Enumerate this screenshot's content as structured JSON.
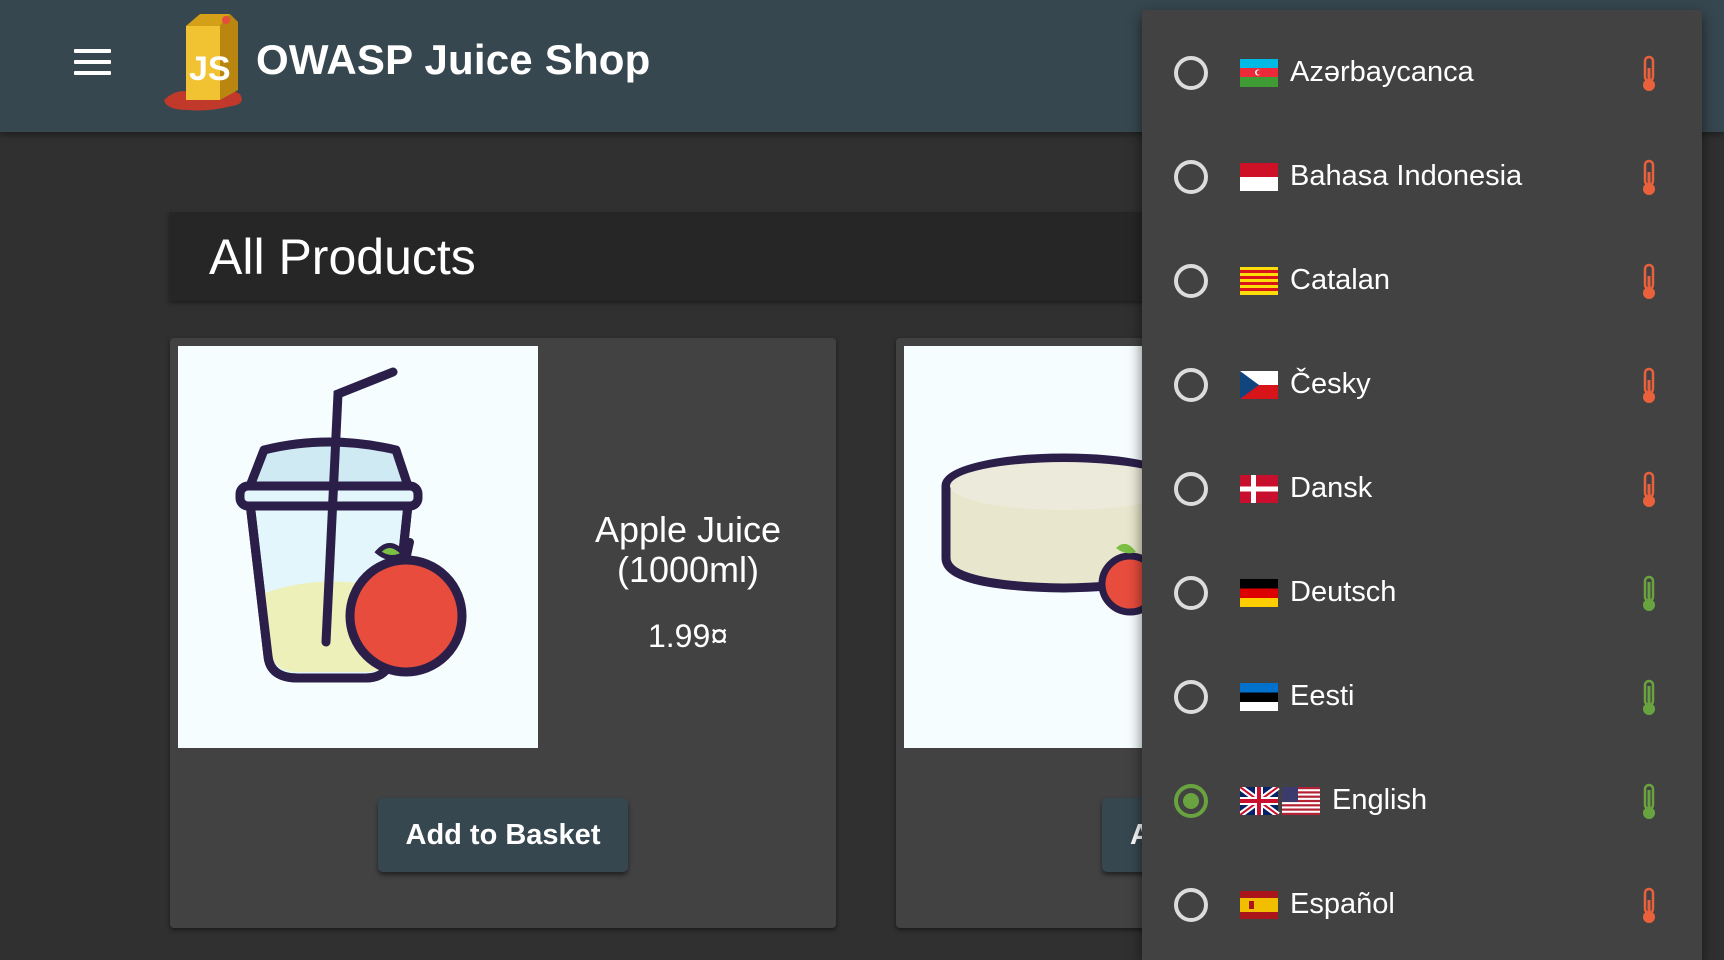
{
  "app": {
    "title": "OWASP Juice Shop"
  },
  "main": {
    "heading": "All Products"
  },
  "products": [
    {
      "name": "Apple Juice (1000ml)",
      "price": "1.99¤",
      "button_label": "Add to Basket"
    },
    {
      "name": "",
      "price": "",
      "button_label": "A"
    }
  ],
  "language_menu": {
    "items": [
      {
        "label": "Azərbaycanca",
        "flag": "az",
        "selected": false,
        "status_color": "#e8613a"
      },
      {
        "label": "Bahasa Indonesia",
        "flag": "id",
        "selected": false,
        "status_color": "#e8613a"
      },
      {
        "label": "Catalan",
        "flag": "ca",
        "selected": false,
        "status_color": "#e8613a"
      },
      {
        "label": "Česky",
        "flag": "cz",
        "selected": false,
        "status_color": "#e8613a"
      },
      {
        "label": "Dansk",
        "flag": "dk",
        "selected": false,
        "status_color": "#e8613a"
      },
      {
        "label": "Deutsch",
        "flag": "de",
        "selected": false,
        "status_color": "#69a33f"
      },
      {
        "label": "Eesti",
        "flag": "ee",
        "selected": false,
        "status_color": "#69a33f"
      },
      {
        "label": "English",
        "flag": "gb-us",
        "selected": true,
        "status_color": "#69a33f"
      },
      {
        "label": "Español",
        "flag": "es",
        "selected": false,
        "status_color": "#e8613a"
      }
    ]
  },
  "colors": {
    "toolbar": "#37474f",
    "background": "#303030",
    "card": "#424242",
    "accent_selected": "#69a33f",
    "status_warning": "#e8613a"
  }
}
